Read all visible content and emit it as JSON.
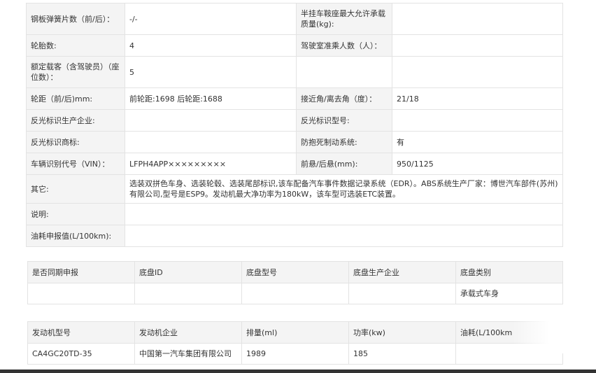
{
  "spec": {
    "rows": [
      {
        "l1": "钢板弹簧片数（前/后）：",
        "v1": "-/-",
        "l2": "半挂车鞍座最大允许承载质量(kg):",
        "v2": ""
      },
      {
        "l1": "轮胎数:",
        "v1": "4",
        "l2": "驾驶室准乘人数（人）：",
        "v2": ""
      },
      {
        "l1": "额定载客（含驾驶员）（座位数）：",
        "v1": "5",
        "l2": "",
        "v2": ""
      },
      {
        "l1": "轮距（前/后)mm:",
        "v1": "前轮距:1698 后轮距:1688",
        "l2": "接近角/离去角（度）：",
        "v2": "21/18"
      },
      {
        "l1": "反光标识生产企业:",
        "v1": "",
        "l2": "反光标识型号:",
        "v2": ""
      },
      {
        "l1": "反光标识商标:",
        "v1": "",
        "l2": "防抱死制动系统:",
        "v2": "有"
      },
      {
        "l1": "车辆识别代号（VIN）：",
        "v1": "LFPH4APP×××××××××",
        "l2": "前悬/后悬(mm):",
        "v2": "950/1125"
      }
    ],
    "other_label": "其它:",
    "other_value": "选装双拼色车身、选装轮毂、选装尾部标识,该车配备汽车事件数据记录系统（EDR）。ABS系统生产厂家：博世汽车部件(苏州)有限公司,型号是ESP9。发动机最大净功率为180kW，该车型可选装ETC装置。",
    "note_label": "说明:",
    "note_value": "",
    "fuel_label": "油耗申报值(L/100km):",
    "fuel_value": ""
  },
  "chassis": {
    "headers": [
      "是否同期申报",
      "底盘ID",
      "底盘型号",
      "底盘生产企业",
      "底盘类别"
    ],
    "rows": [
      [
        "",
        "",
        "",
        "",
        "承载式车身"
      ]
    ]
  },
  "engine": {
    "headers": [
      "发动机型号",
      "发动机企业",
      "排量(ml)",
      "功率(kw)",
      "油耗(L/100km"
    ],
    "rows": [
      [
        "CA4GC20TD-35",
        "中国第一汽车集团有限公司",
        "1989",
        "185",
        ""
      ]
    ]
  }
}
